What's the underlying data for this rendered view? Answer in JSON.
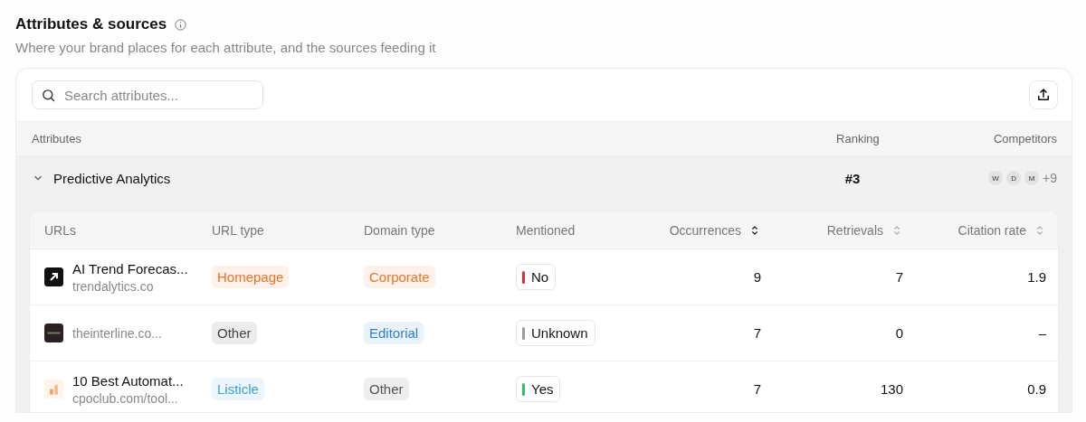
{
  "section": {
    "title": "Attributes & sources",
    "subtitle": "Where your brand places for each attribute, and the sources feeding it"
  },
  "search": {
    "placeholder": "Search attributes..."
  },
  "table": {
    "columns": [
      "Attributes",
      "Ranking",
      "Competitors"
    ],
    "groups": [
      {
        "name": "Predictive Analytics",
        "expanded": true,
        "ranking": "#3",
        "competitors": [
          "W",
          "D",
          "M"
        ],
        "more": "+9",
        "sources": {
          "columns": [
            {
              "label": "URLs"
            },
            {
              "label": "URL type"
            },
            {
              "label": "Domain type"
            },
            {
              "label": "Mentioned"
            },
            {
              "label": "Occurrences",
              "sortable": true,
              "sorted": true
            },
            {
              "label": "Retrievals",
              "sortable": true,
              "sorted": false
            },
            {
              "label": "Citation rate",
              "sortable": true,
              "sorted": false
            }
          ],
          "rows": [
            {
              "title": "AI Trend Forecas...",
              "url": "trendalytics.co",
              "url_type": {
                "label": "Homepage",
                "color": "#e8742a"
              },
              "domain_type": {
                "label": "Corporate",
                "color": "#e8742a"
              },
              "mentioned": {
                "label": "No",
                "color": "#d9303a"
              },
              "occurrences": "9",
              "retrievals": "7",
              "citation_rate": "1.9"
            },
            {
              "url": "theinterline.co...",
              "url_type": {
                "label": "Other",
                "color": "#444444"
              },
              "domain_type": {
                "label": "Editorial",
                "color": "#2f7fd0"
              },
              "mentioned": {
                "label": "Unknown",
                "color": "#9a9a9a"
              },
              "occurrences": "7",
              "retrievals": "0",
              "citation_rate": "–"
            },
            {
              "title": "10 Best Automat...",
              "url": "cpoclub.com/tool...",
              "url_type": {
                "label": "Listicle",
                "color": "#3aa0d8"
              },
              "domain_type": {
                "label": "Other",
                "color": "#555555"
              },
              "mentioned": {
                "label": "Yes",
                "color": "#2fbf6a"
              },
              "occurrences": "7",
              "retrievals": "130",
              "citation_rate": "0.9"
            }
          ]
        }
      }
    ]
  }
}
